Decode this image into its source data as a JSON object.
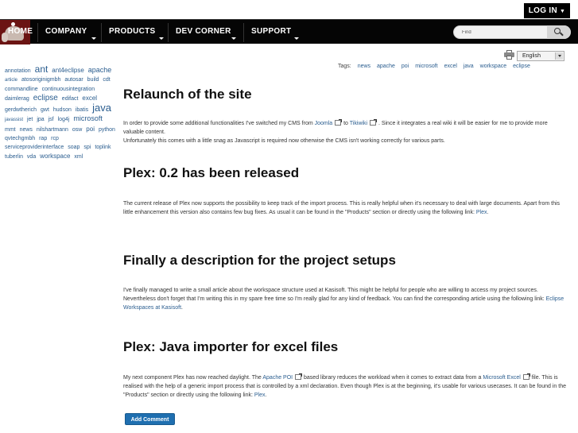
{
  "header": {
    "login_label": "LOG IN",
    "nav": [
      {
        "label": "HOME"
      },
      {
        "label": "COMPANY"
      },
      {
        "label": "PRODUCTS"
      },
      {
        "label": "DEV CORNER"
      },
      {
        "label": "SUPPORT"
      }
    ],
    "search": {
      "value": "Find"
    }
  },
  "tag_cloud": [
    "annotation",
    "ant",
    "ant4eclipse",
    "apache",
    "article",
    "atosoriginigmbh",
    "autosar",
    "build",
    "cdt",
    "commandline",
    "continuousintegration",
    "daimlerag",
    "eclipse",
    "edifact",
    "excel",
    "gerdwtherich",
    "gwt",
    "hudson",
    "ibatis",
    "java",
    "javassist",
    "jet",
    "jpa",
    "jsf",
    "log4j",
    "microsoft",
    "mmt",
    "news",
    "nilshartmann",
    "osw",
    "poi",
    "python",
    "qvtechgmbh",
    "rap",
    "rcp",
    "serviceproviderinterface",
    "soap",
    "spi",
    "toplink",
    "tuberlin",
    "vda",
    "workspace",
    "xml"
  ],
  "tools": {
    "printer_icon": "printer-icon",
    "language": "English"
  },
  "tags_bar": {
    "label": "Tags:",
    "items": [
      "news",
      "apache",
      "poi",
      "microsoft",
      "excel",
      "java",
      "workspace",
      "eclipse"
    ]
  },
  "articles": [
    {
      "title": "Relaunch of the site",
      "p1_a": "In order to provide some additional functionalities I've switched my CMS from ",
      "link1": "Joomla",
      "p1_b": " to ",
      "link2": "Tikiwiki",
      "p1_c": " . Since it integrates a real wiki it will be easier for me to provide more valuable content.",
      "p2": "Unfortunately this comes with a little snag as Javascript is required now otherwise the CMS isn't working correctly for various parts."
    },
    {
      "title": "Plex: 0.2 has been released",
      "p1_a": "The current release of Plex now supports the possibility to keep track of the import process. This is really helpful when it's necessary to deal with large documents. Apart from this little enhancement this version also contains few bug fixes. As usual it can be found in the \"Products\" section or directly using the following link: ",
      "link1": "Plex",
      "p1_b": "."
    },
    {
      "title": "Finally a description for the project setups",
      "p1_a": "I've finally managed to write a small article about the workspace structure used at Kasisoft. This might be helpful for people who are willing to access my project sources. Nevertheless don't forget that I'm writing this in my spare free time so I'm really glad for any kind of feedback. You can find the corresponding article using the following link: ",
      "link1": "Eclipse Workspaces at Kasisoft",
      "p1_b": "."
    },
    {
      "title": "Plex: Java importer for excel files",
      "p1_a": "My next component Plex has now reached daylight. The ",
      "link1": "Apache POI",
      "p1_b": " based library reduces the workload when it comes to extract data from a ",
      "link2": "Microsoft Excel",
      "p1_c": " file. This is realised with the help of a generic import process that is controlled by a xml declaration. Even though Plex is at the beginning, it's usable for various usecases. It can be found in the \"Products\" section or directly using the following link: ",
      "link3": "Plex",
      "p1_d": "."
    }
  ],
  "add_comment_label": "Add Comment"
}
